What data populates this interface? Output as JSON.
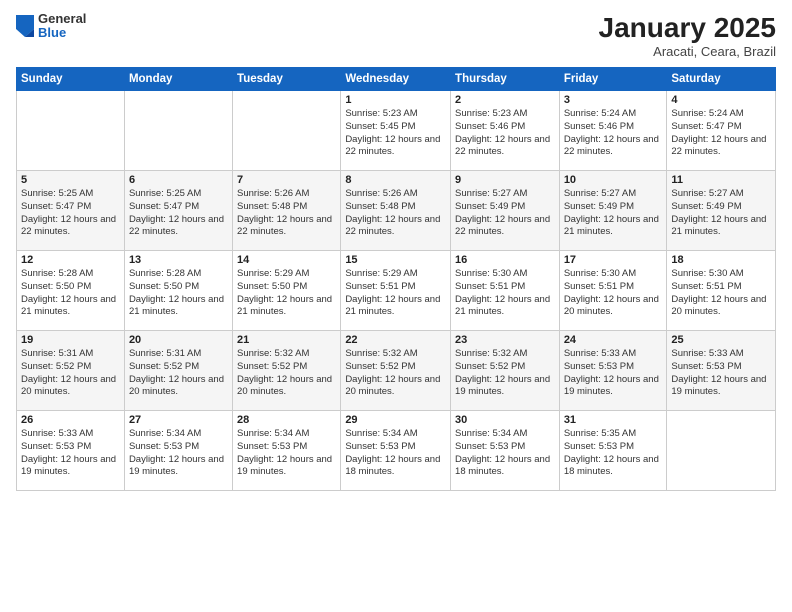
{
  "logo": {
    "general": "General",
    "blue": "Blue"
  },
  "title": "January 2025",
  "subtitle": "Aracati, Ceara, Brazil",
  "weekdays": [
    "Sunday",
    "Monday",
    "Tuesday",
    "Wednesday",
    "Thursday",
    "Friday",
    "Saturday"
  ],
  "weeks": [
    [
      {
        "date": "",
        "sunrise": "",
        "sunset": "",
        "daylight": ""
      },
      {
        "date": "",
        "sunrise": "",
        "sunset": "",
        "daylight": ""
      },
      {
        "date": "",
        "sunrise": "",
        "sunset": "",
        "daylight": ""
      },
      {
        "date": "1",
        "sunrise": "Sunrise: 5:23 AM",
        "sunset": "Sunset: 5:45 PM",
        "daylight": "Daylight: 12 hours and 22 minutes."
      },
      {
        "date": "2",
        "sunrise": "Sunrise: 5:23 AM",
        "sunset": "Sunset: 5:46 PM",
        "daylight": "Daylight: 12 hours and 22 minutes."
      },
      {
        "date": "3",
        "sunrise": "Sunrise: 5:24 AM",
        "sunset": "Sunset: 5:46 PM",
        "daylight": "Daylight: 12 hours and 22 minutes."
      },
      {
        "date": "4",
        "sunrise": "Sunrise: 5:24 AM",
        "sunset": "Sunset: 5:47 PM",
        "daylight": "Daylight: 12 hours and 22 minutes."
      }
    ],
    [
      {
        "date": "5",
        "sunrise": "Sunrise: 5:25 AM",
        "sunset": "Sunset: 5:47 PM",
        "daylight": "Daylight: 12 hours and 22 minutes."
      },
      {
        "date": "6",
        "sunrise": "Sunrise: 5:25 AM",
        "sunset": "Sunset: 5:47 PM",
        "daylight": "Daylight: 12 hours and 22 minutes."
      },
      {
        "date": "7",
        "sunrise": "Sunrise: 5:26 AM",
        "sunset": "Sunset: 5:48 PM",
        "daylight": "Daylight: 12 hours and 22 minutes."
      },
      {
        "date": "8",
        "sunrise": "Sunrise: 5:26 AM",
        "sunset": "Sunset: 5:48 PM",
        "daylight": "Daylight: 12 hours and 22 minutes."
      },
      {
        "date": "9",
        "sunrise": "Sunrise: 5:27 AM",
        "sunset": "Sunset: 5:49 PM",
        "daylight": "Daylight: 12 hours and 22 minutes."
      },
      {
        "date": "10",
        "sunrise": "Sunrise: 5:27 AM",
        "sunset": "Sunset: 5:49 PM",
        "daylight": "Daylight: 12 hours and 21 minutes."
      },
      {
        "date": "11",
        "sunrise": "Sunrise: 5:27 AM",
        "sunset": "Sunset: 5:49 PM",
        "daylight": "Daylight: 12 hours and 21 minutes."
      }
    ],
    [
      {
        "date": "12",
        "sunrise": "Sunrise: 5:28 AM",
        "sunset": "Sunset: 5:50 PM",
        "daylight": "Daylight: 12 hours and 21 minutes."
      },
      {
        "date": "13",
        "sunrise": "Sunrise: 5:28 AM",
        "sunset": "Sunset: 5:50 PM",
        "daylight": "Daylight: 12 hours and 21 minutes."
      },
      {
        "date": "14",
        "sunrise": "Sunrise: 5:29 AM",
        "sunset": "Sunset: 5:50 PM",
        "daylight": "Daylight: 12 hours and 21 minutes."
      },
      {
        "date": "15",
        "sunrise": "Sunrise: 5:29 AM",
        "sunset": "Sunset: 5:51 PM",
        "daylight": "Daylight: 12 hours and 21 minutes."
      },
      {
        "date": "16",
        "sunrise": "Sunrise: 5:30 AM",
        "sunset": "Sunset: 5:51 PM",
        "daylight": "Daylight: 12 hours and 21 minutes."
      },
      {
        "date": "17",
        "sunrise": "Sunrise: 5:30 AM",
        "sunset": "Sunset: 5:51 PM",
        "daylight": "Daylight: 12 hours and 20 minutes."
      },
      {
        "date": "18",
        "sunrise": "Sunrise: 5:30 AM",
        "sunset": "Sunset: 5:51 PM",
        "daylight": "Daylight: 12 hours and 20 minutes."
      }
    ],
    [
      {
        "date": "19",
        "sunrise": "Sunrise: 5:31 AM",
        "sunset": "Sunset: 5:52 PM",
        "daylight": "Daylight: 12 hours and 20 minutes."
      },
      {
        "date": "20",
        "sunrise": "Sunrise: 5:31 AM",
        "sunset": "Sunset: 5:52 PM",
        "daylight": "Daylight: 12 hours and 20 minutes."
      },
      {
        "date": "21",
        "sunrise": "Sunrise: 5:32 AM",
        "sunset": "Sunset: 5:52 PM",
        "daylight": "Daylight: 12 hours and 20 minutes."
      },
      {
        "date": "22",
        "sunrise": "Sunrise: 5:32 AM",
        "sunset": "Sunset: 5:52 PM",
        "daylight": "Daylight: 12 hours and 20 minutes."
      },
      {
        "date": "23",
        "sunrise": "Sunrise: 5:32 AM",
        "sunset": "Sunset: 5:52 PM",
        "daylight": "Daylight: 12 hours and 19 minutes."
      },
      {
        "date": "24",
        "sunrise": "Sunrise: 5:33 AM",
        "sunset": "Sunset: 5:53 PM",
        "daylight": "Daylight: 12 hours and 19 minutes."
      },
      {
        "date": "25",
        "sunrise": "Sunrise: 5:33 AM",
        "sunset": "Sunset: 5:53 PM",
        "daylight": "Daylight: 12 hours and 19 minutes."
      }
    ],
    [
      {
        "date": "26",
        "sunrise": "Sunrise: 5:33 AM",
        "sunset": "Sunset: 5:53 PM",
        "daylight": "Daylight: 12 hours and 19 minutes."
      },
      {
        "date": "27",
        "sunrise": "Sunrise: 5:34 AM",
        "sunset": "Sunset: 5:53 PM",
        "daylight": "Daylight: 12 hours and 19 minutes."
      },
      {
        "date": "28",
        "sunrise": "Sunrise: 5:34 AM",
        "sunset": "Sunset: 5:53 PM",
        "daylight": "Daylight: 12 hours and 19 minutes."
      },
      {
        "date": "29",
        "sunrise": "Sunrise: 5:34 AM",
        "sunset": "Sunset: 5:53 PM",
        "daylight": "Daylight: 12 hours and 18 minutes."
      },
      {
        "date": "30",
        "sunrise": "Sunrise: 5:34 AM",
        "sunset": "Sunset: 5:53 PM",
        "daylight": "Daylight: 12 hours and 18 minutes."
      },
      {
        "date": "31",
        "sunrise": "Sunrise: 5:35 AM",
        "sunset": "Sunset: 5:53 PM",
        "daylight": "Daylight: 12 hours and 18 minutes."
      },
      {
        "date": "",
        "sunrise": "",
        "sunset": "",
        "daylight": ""
      }
    ]
  ]
}
